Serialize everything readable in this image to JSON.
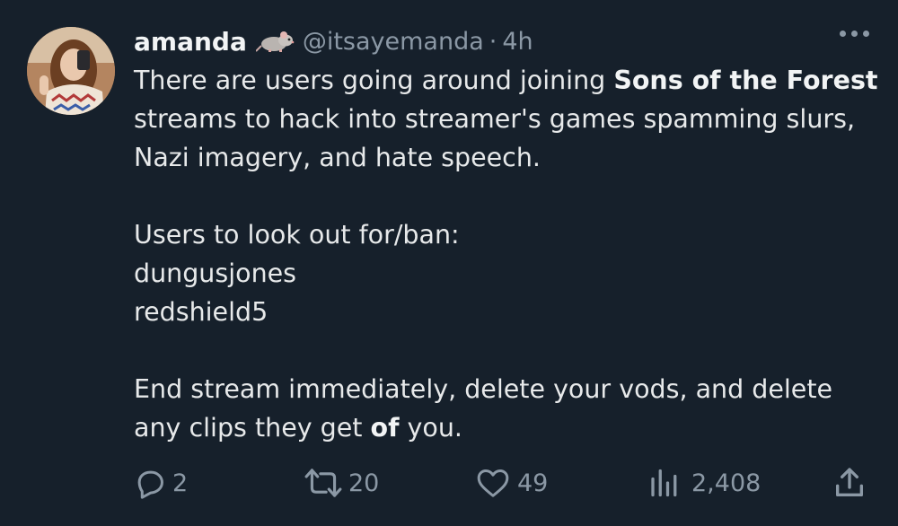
{
  "tweet": {
    "author": {
      "display_name": "amanda",
      "badge_icon": "rat-emoji-icon",
      "handle": "@itsayemanda",
      "separator": "·",
      "time": "4h"
    },
    "body": {
      "line1_pre": "There are users going around joining ",
      "line1_bold": "Sons of the Forest",
      "line1_post": " streams to hack into streamer's games spamming slurs, Nazi imagery, and hate speech.",
      "list_intro": "Users to look out for/ban:",
      "users": [
        "dungusjones",
        "redshield5"
      ],
      "final_pre": "End stream immediately, delete your vods, and delete any clips they get ",
      "final_bold": "of",
      "final_post": " you."
    },
    "actions": {
      "reply": {
        "icon": "reply-icon",
        "count": "2"
      },
      "retweet": {
        "icon": "retweet-icon",
        "count": "20"
      },
      "like": {
        "icon": "heart-icon",
        "count": "49"
      },
      "views": {
        "icon": "views-icon",
        "count": "2,408"
      },
      "share": {
        "icon": "share-icon"
      }
    }
  },
  "colors": {
    "background": "#16202b",
    "text": "#e7e9ea",
    "muted": "#8b98a5"
  }
}
